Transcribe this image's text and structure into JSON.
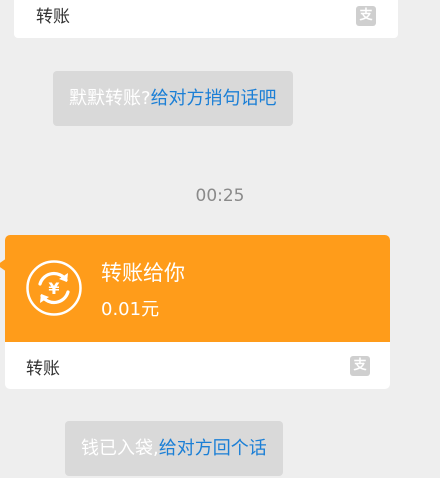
{
  "top_card": {
    "footer_label": "转账",
    "icon": "alipay-icon"
  },
  "notice_1": {
    "prefix": "默默转账?",
    "link": "给对方捎句话吧"
  },
  "timestamp": "00:25",
  "transfer_card": {
    "title": "转账给你",
    "amount": "0.01元",
    "footer_label": "转账",
    "icon": "transfer-yuan-icon",
    "footer_icon": "alipay-icon",
    "color": "#ff9c1a"
  },
  "notice_2": {
    "prefix": "钱已入袋,",
    "link": "给对方回个话"
  },
  "colors": {
    "background": "#eeeeee",
    "notice_bg": "#d9d9d9",
    "link": "#1b7fd6",
    "accent": "#ff9c1a"
  }
}
